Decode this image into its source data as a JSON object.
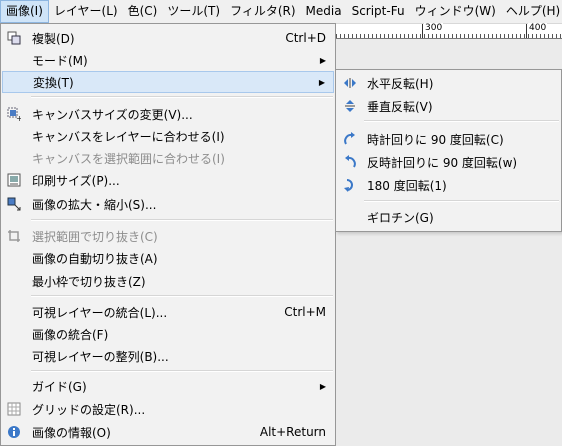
{
  "menubar": {
    "items": [
      {
        "label": "画像(I)"
      },
      {
        "label": "レイヤー(L)"
      },
      {
        "label": "色(C)"
      },
      {
        "label": "ツール(T)"
      },
      {
        "label": "フィルタ(R)"
      },
      {
        "label": "Media"
      },
      {
        "label": "Script-Fu"
      },
      {
        "label": "ウィンドウ(W)"
      },
      {
        "label": "ヘルプ(H)"
      }
    ]
  },
  "ruler": {
    "labels": [
      "300",
      "400"
    ]
  },
  "image_menu": {
    "duplicate": {
      "label": "複製(D)",
      "shortcut": "Ctrl+D",
      "icon": "duplicate-icon"
    },
    "mode": {
      "label": "モード(M)"
    },
    "transform": {
      "label": "変換(T)"
    },
    "canvas_size": {
      "label": "キャンバスサイズの変更(V)...",
      "icon": "canvas-size-icon"
    },
    "fit_canvas_layers": {
      "label": "キャンバスをレイヤーに合わせる(I)"
    },
    "fit_canvas_selection": {
      "label": "キャンバスを選択範囲に合わせる(I)"
    },
    "print_size": {
      "label": "印刷サイズ(P)...",
      "icon": "print-size-icon"
    },
    "scale_image": {
      "label": "画像の拡大・縮小(S)...",
      "icon": "scale-icon"
    },
    "crop_selection": {
      "label": "選択範囲で切り抜き(C)",
      "icon": "crop-icon"
    },
    "autocrop": {
      "label": "画像の自動切り抜き(A)"
    },
    "zealous_crop": {
      "label": "最小枠で切り抜き(Z)"
    },
    "merge_visible": {
      "label": "可視レイヤーの統合(L)...",
      "shortcut": "Ctrl+M"
    },
    "flatten": {
      "label": "画像の統合(F)"
    },
    "align_layers": {
      "label": "可視レイヤーの整列(B)..."
    },
    "guides": {
      "label": "ガイド(G)"
    },
    "grid": {
      "label": "グリッドの設定(R)...",
      "icon": "grid-icon"
    },
    "properties": {
      "label": "画像の情報(O)",
      "shortcut": "Alt+Return",
      "icon": "info-icon"
    }
  },
  "transform_menu": {
    "flip_h": {
      "label": "水平反転(H)",
      "icon": "flip-horizontal-icon"
    },
    "flip_v": {
      "label": "垂直反転(V)",
      "icon": "flip-vertical-icon"
    },
    "rot_cw": {
      "label": "時計回りに 90 度回転(C)",
      "icon": "rotate-cw-icon"
    },
    "rot_ccw": {
      "label": "反時計回りに 90 度回転(w)",
      "icon": "rotate-ccw-icon"
    },
    "rot_180": {
      "label": "180 度回転(1)",
      "icon": "rotate-180-icon"
    },
    "guillotine": {
      "label": "ギロチン(G)"
    }
  },
  "colors": {
    "highlight": "#d9e8f8",
    "active_menubar": "#cfe4f8",
    "disabled_text": "#8d8d8d"
  }
}
